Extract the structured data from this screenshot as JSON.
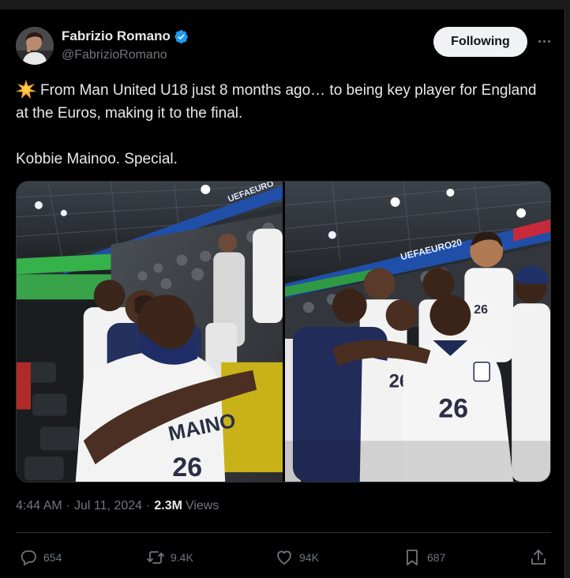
{
  "author": {
    "name": "Fabrizio Romano",
    "handle": "@FabrizioRomano",
    "verified": true,
    "verified_color": "#1d9bf0"
  },
  "header": {
    "follow_label": "Following",
    "more_icon": "more-horizontal-icon"
  },
  "tweet": {
    "emoji_icon": "sparkle-emoji",
    "line1": "From Man United U18 just 8 months ago… to being key player for England at the Euros, making it to the final.",
    "line2": "Kobbie Mainoo. Special."
  },
  "media": {
    "count": 2,
    "left_banner": "UEFAEURO",
    "right_banner": "UEFAEURO20",
    "shirt_text_left": "MAINO",
    "shirt_number": "26"
  },
  "meta": {
    "time": "4:44 AM",
    "date": "Jul 11, 2024",
    "views_count": "2.3M",
    "views_label": "Views"
  },
  "actions": {
    "replies": "654",
    "reposts": "9.4K",
    "likes": "94K",
    "bookmarks": "687"
  },
  "colors": {
    "background": "#000000",
    "text": "#e7e9ea",
    "muted": "#71767b",
    "border": "#2f3336",
    "follow_button_bg": "#eff3f4"
  }
}
